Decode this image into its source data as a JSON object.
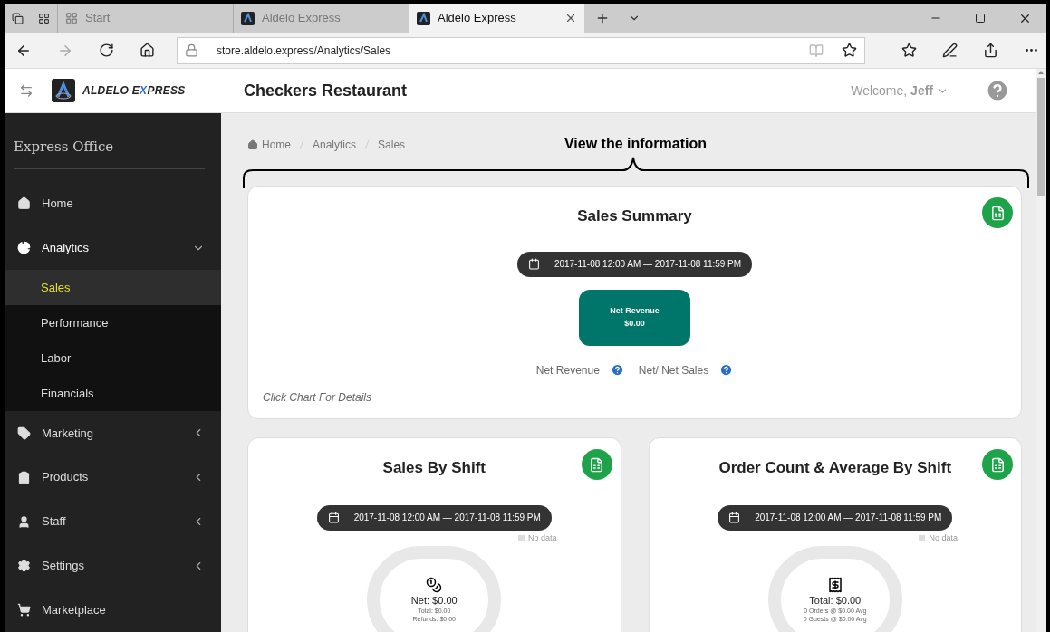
{
  "browser": {
    "tabs": [
      {
        "kind": "start",
        "title": "Start",
        "selected": false
      },
      {
        "kind": "site",
        "title": "Aldelo Express",
        "selected": false
      },
      {
        "kind": "site",
        "title": "Aldelo Express",
        "selected": true
      }
    ],
    "url": "store.aldelo.express/Analytics/Sales"
  },
  "header": {
    "brand": {
      "before": "ALDELO E",
      "accent": "X",
      "after": "PRESS"
    },
    "restaurant": "Checkers Restaurant",
    "welcome": "Welcome, **Jeff**"
  },
  "sidebar": {
    "title": "Express Office",
    "items": [
      {
        "kind": "home",
        "label": "Home"
      },
      {
        "kind": "analytics",
        "label": "Analytics",
        "expanded": true,
        "children": [
          {
            "label": "Sales",
            "selected": true
          },
          {
            "label": "Performance",
            "selected": false
          },
          {
            "label": "Labor",
            "selected": false
          },
          {
            "label": "Financials",
            "selected": false
          }
        ]
      },
      {
        "kind": "marketing",
        "label": "Marketing",
        "expanded": false
      },
      {
        "kind": "products",
        "label": "Products",
        "expanded": false
      },
      {
        "kind": "staff",
        "label": "Staff",
        "expanded": false
      },
      {
        "kind": "settings",
        "label": "Settings",
        "expanded": false
      },
      {
        "kind": "marketplace",
        "label": "Marketplace"
      }
    ]
  },
  "breadcrumb": [
    "Home",
    "Analytics",
    "Sales"
  ],
  "annotation": "View the information",
  "summary": {
    "title": "Sales Summary",
    "date_range": "2017-11-08 12:00 AM — 2017-11-08 11:59 PM",
    "tile": {
      "label": "Net Revenue",
      "value": "$0.00"
    },
    "legend": [
      "Net Revenue",
      "Net/ Net Sales"
    ],
    "hint": "Click Chart For Details"
  },
  "cards": [
    {
      "kind": "sales",
      "title": "Sales By Shift",
      "date_range": "2017-11-08 12:00 AM — 2017-11-08 11:59 PM",
      "legend": "No data",
      "main": "Net: $0.00",
      "lines": [
        "Total: $0.00",
        "Refunds: $0.00"
      ]
    },
    {
      "kind": "orders",
      "title": "Order Count & Average By Shift",
      "date_range": "2017-11-08 12:00 AM — 2017-11-08 11:59 PM",
      "legend": "No data",
      "main": "Total: $0.00",
      "lines": [
        "0 Orders @ $0.00 Avg",
        "0 Guests @ $0.00 Avg"
      ]
    }
  ]
}
